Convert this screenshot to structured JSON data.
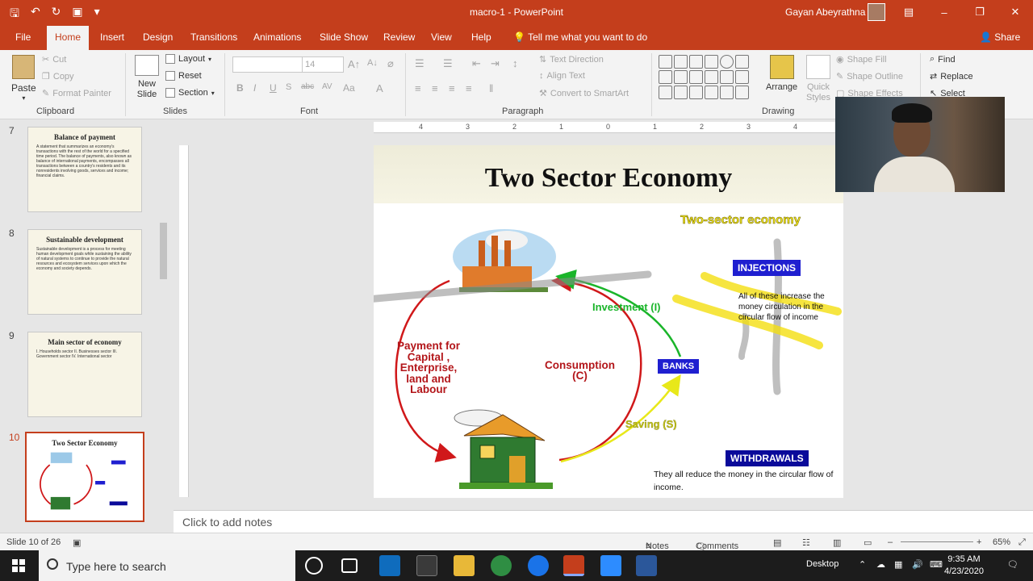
{
  "app": {
    "document_title": "macro-1  -  PowerPoint",
    "user_name": "Gayan Abeyrathna"
  },
  "ribbon_tabs": [
    "File",
    "Home",
    "Insert",
    "Design",
    "Transitions",
    "Animations",
    "Slide Show",
    "Review",
    "View",
    "Help"
  ],
  "tell_me": "Tell me what you want to do",
  "share": "Share",
  "ribbon": {
    "clipboard": {
      "label": "Clipboard",
      "paste": "Paste",
      "cut": "Cut",
      "copy": "Copy",
      "format_painter": "Format Painter"
    },
    "slides": {
      "label": "Slides",
      "new_slide": "New Slide",
      "layout": "Layout",
      "reset": "Reset",
      "section": "Section"
    },
    "font": {
      "label": "Font",
      "size": "14"
    },
    "paragraph": {
      "label": "Paragraph",
      "text_direction": "Text Direction",
      "align_text": "Align Text",
      "convert_smartart": "Convert to SmartArt"
    },
    "drawing": {
      "label": "Drawing",
      "arrange": "Arrange",
      "quick_styles": "Quick Styles",
      "shape_fill": "Shape Fill",
      "shape_outline": "Shape Outline",
      "shape_effects": "Shape Effects"
    },
    "editing": {
      "find": "Find",
      "replace": "Replace",
      "select": "Select"
    }
  },
  "thumbnails": [
    {
      "num": "7",
      "title": "Balance of payment",
      "text": "A statement that summarizes an economy's transactions with the rest of the world for a specified time period. The balance of payments, also known as balance of international payments, encompasses all transactions between a country's residents and its nonresidents involving goods, services and income; financial claims."
    },
    {
      "num": "8",
      "title": "Sustainable development",
      "text": "Sustainable development is a process for meeting human development goals while sustaining the ability of natural systems to continue to provide the natural resources and ecosystem services upon which the economy and society depends."
    },
    {
      "num": "9",
      "title": "Main sector of economy",
      "text": "I. Households sector  II. Businesses sector  III. Government sector  IV. International sector"
    },
    {
      "num": "10",
      "title": "Two Sector Economy",
      "text": ""
    }
  ],
  "slide": {
    "title": "Two Sector Economy",
    "diagram_title": "Two-sector economy",
    "injections": "INJECTIONS",
    "injections_text": "All of these increase the money circulation in the circular flow of income",
    "withdrawals": "WITHDRAWALS",
    "withdrawals_text": "They all reduce the money in the circular flow of income.",
    "banks": "BANKS",
    "investment": "Investment (I)",
    "consumption_1": "Consumption",
    "consumption_2": "(C)",
    "payment_lines": [
      "Payment for",
      "Capital ,",
      "Enterprise,",
      "land and",
      "Labour"
    ],
    "saving": "Saving (S)"
  },
  "notes_placeholder": "Click to add notes",
  "status": {
    "slide_info": "Slide 10 of 26",
    "notes": "Notes",
    "comments": "Comments",
    "zoom": "65%"
  },
  "taskbar": {
    "search_placeholder": "Type here to search",
    "desktop": "Desktop",
    "time": "9:35 AM",
    "date": "4/23/2020"
  },
  "colors": {
    "accent": "#c43e1c",
    "injection_box": "#1f1fd0",
    "withdrawal_box": "#0a0a9a",
    "consumption_arrow": "#d0181a",
    "investment_arrow": "#1ab52a",
    "saving_arrow": "#e8e81a"
  }
}
